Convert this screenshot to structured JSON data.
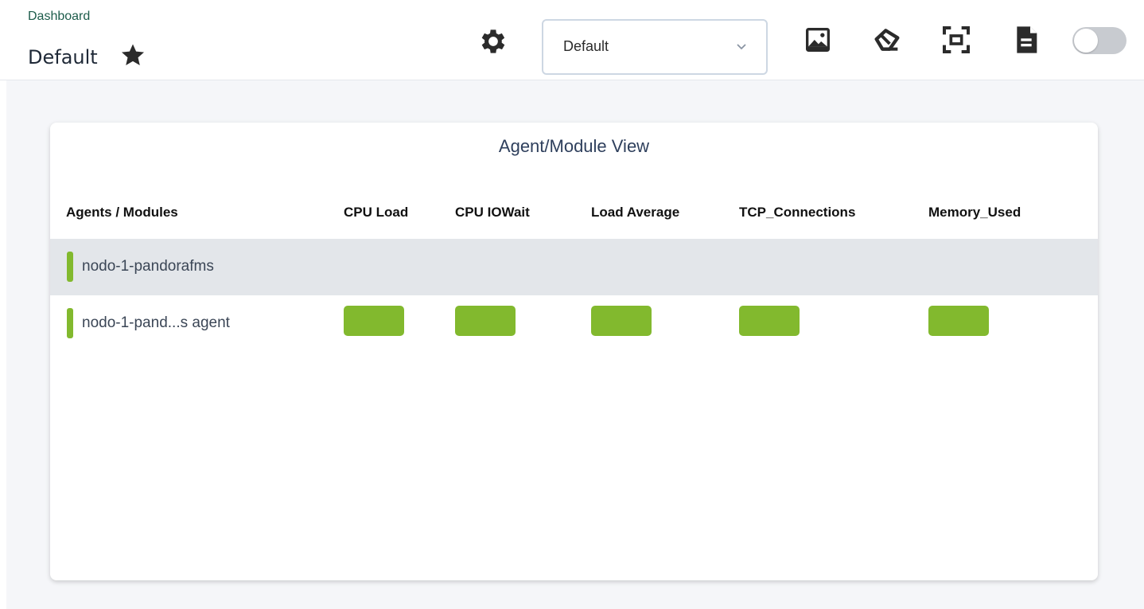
{
  "header": {
    "breadcrumb": "Dashboard",
    "title": "Default",
    "select": {
      "value": "Default"
    },
    "icons": {
      "favorite": "star-icon",
      "settings": "gear-icon",
      "image": "image-icon",
      "eraser": "eraser-icon",
      "fullscreen": "fullscreen-icon",
      "document": "document-icon"
    },
    "toggle": {
      "state": "off"
    }
  },
  "widget": {
    "title": "Agent/Module View",
    "columns": [
      "Agents / Modules",
      "CPU Load",
      "CPU IOWait",
      "Load Average",
      "TCP_Connections",
      "Memory_Used"
    ],
    "rows": [
      {
        "label": "nodo-1-pandorafms",
        "status_color": "#82b92e",
        "cells": []
      },
      {
        "label": "nodo-1-pand...s agent",
        "status_color": "#82b92e",
        "cells": [
          "ok",
          "ok",
          "ok",
          "ok",
          "ok"
        ]
      }
    ]
  },
  "colors": {
    "accent_green": "#82b92e",
    "breadcrumb": "#1d5c4b",
    "title_text": "#2e3f5c",
    "row_highlight": "#e3e6ea",
    "background": "#f5f6f9"
  }
}
